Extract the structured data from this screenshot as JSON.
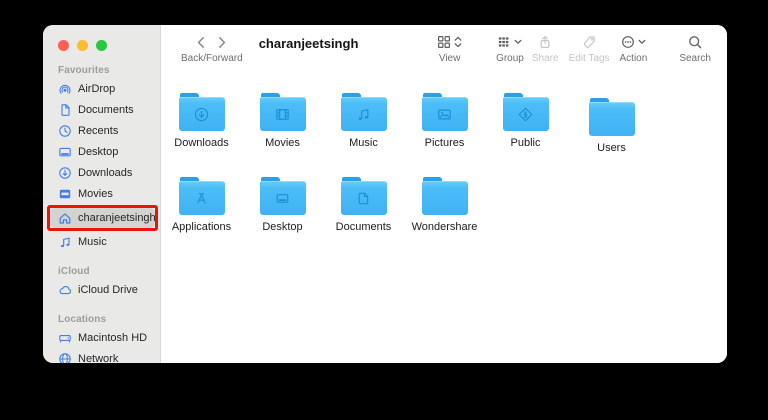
{
  "window": {
    "title": "charanjeetsingh",
    "traffic_lights": [
      {
        "name": "close",
        "color": "#ff5f57"
      },
      {
        "name": "minimize",
        "color": "#febc2e"
      },
      {
        "name": "zoom",
        "color": "#28c840"
      }
    ]
  },
  "toolbar": {
    "back_forward_label": "Back/Forward",
    "tools": [
      {
        "id": "view",
        "label": "View",
        "icon": "grid-view-icon",
        "chevron": "updown",
        "enabled": true
      },
      {
        "id": "group",
        "label": "Group",
        "icon": "group-icon",
        "chevron": "down",
        "enabled": true
      },
      {
        "id": "share",
        "label": "Share",
        "icon": "share-icon",
        "chevron": null,
        "enabled": false
      },
      {
        "id": "tags",
        "label": "Edit Tags",
        "icon": "tag-icon",
        "chevron": null,
        "enabled": false
      },
      {
        "id": "action",
        "label": "Action",
        "icon": "action-icon",
        "chevron": "down",
        "enabled": true
      },
      {
        "id": "search",
        "label": "Search",
        "icon": "search-icon",
        "chevron": null,
        "enabled": true
      }
    ]
  },
  "sidebar": {
    "sections": [
      {
        "label": "Favourites",
        "items": [
          {
            "label": "AirDrop",
            "icon": "airdrop-icon"
          },
          {
            "label": "Documents",
            "icon": "document-icon"
          },
          {
            "label": "Recents",
            "icon": "clock-icon"
          },
          {
            "label": "Desktop",
            "icon": "desktop-icon"
          },
          {
            "label": "Downloads",
            "icon": "download-icon"
          },
          {
            "label": "Movies",
            "icon": "film-icon"
          },
          {
            "label": "charanjeetsingh",
            "icon": "home-icon",
            "selected": true,
            "annotated": true
          },
          {
            "label": "Music",
            "icon": "music-icon"
          }
        ]
      },
      {
        "label": "iCloud",
        "items": [
          {
            "label": "iCloud Drive",
            "icon": "cloud-icon"
          }
        ]
      },
      {
        "label": "Locations",
        "items": [
          {
            "label": "Macintosh HD",
            "icon": "harddrive-icon"
          },
          {
            "label": "Network",
            "icon": "globe-icon"
          }
        ]
      }
    ]
  },
  "content": {
    "folders": [
      {
        "label": "Downloads",
        "glyph": "download-glyph"
      },
      {
        "label": "Movies",
        "glyph": "film-glyph"
      },
      {
        "label": "Music",
        "glyph": "music-glyph"
      },
      {
        "label": "Pictures",
        "glyph": "picture-glyph"
      },
      {
        "label": "Public",
        "glyph": "public-glyph"
      },
      {
        "label": "Users",
        "glyph": null,
        "offset": true
      },
      {
        "label": "Applications",
        "glyph": "applications-glyph"
      },
      {
        "label": "Desktop",
        "glyph": "desktop-glyph"
      },
      {
        "label": "Documents",
        "glyph": "document-glyph"
      },
      {
        "label": "Wondershare",
        "glyph": null
      }
    ]
  },
  "colors": {
    "accent_blue": "#3f7ef0",
    "folder_blue": "#4bbdf7",
    "folder_tab_blue": "#2ba0e8",
    "folder_glyph_blue": "#1b8fd6",
    "annotation_red": "#e8150d",
    "sidebar_bg": "#e9e9e7",
    "selected_bg": "#d3d3d1"
  }
}
